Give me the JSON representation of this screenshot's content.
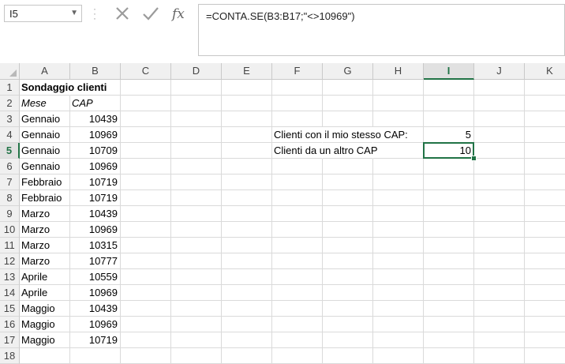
{
  "name_box": {
    "value": "I5"
  },
  "formula_bar": {
    "value": "=CONTA.SE(B3:B17;\"<>10969\")"
  },
  "columns": [
    "A",
    "B",
    "C",
    "D",
    "E",
    "F",
    "G",
    "H",
    "I",
    "J",
    "K"
  ],
  "active_column": "I",
  "active_row": "5",
  "rows": [
    "1",
    "2",
    "3",
    "4",
    "5",
    "6",
    "7",
    "8",
    "9",
    "10",
    "11",
    "12",
    "13",
    "14",
    "15",
    "16",
    "17",
    "18"
  ],
  "sheet": {
    "title": "Sondaggio clienti",
    "headers": {
      "month": "Mese",
      "cap": "CAP"
    },
    "data": [
      {
        "month": "Gennaio",
        "cap": "10439"
      },
      {
        "month": "Gennaio",
        "cap": "10969"
      },
      {
        "month": "Gennaio",
        "cap": "10709"
      },
      {
        "month": "Gennaio",
        "cap": "10969"
      },
      {
        "month": "Febbraio",
        "cap": "10719"
      },
      {
        "month": "Febbraio",
        "cap": "10719"
      },
      {
        "month": "Marzo",
        "cap": "10439"
      },
      {
        "month": "Marzo",
        "cap": "10969"
      },
      {
        "month": "Marzo",
        "cap": "10315"
      },
      {
        "month": "Marzo",
        "cap": "10777"
      },
      {
        "month": "Aprile",
        "cap": "10559"
      },
      {
        "month": "Aprile",
        "cap": "10969"
      },
      {
        "month": "Maggio",
        "cap": "10439"
      },
      {
        "month": "Maggio",
        "cap": "10969"
      },
      {
        "month": "Maggio",
        "cap": "10719"
      }
    ],
    "summary": {
      "same_cap_label": "Clienti con il mio stesso CAP:",
      "same_cap_value": "5",
      "other_cap_label": "Clienti da un altro CAP",
      "other_cap_value": "10"
    }
  },
  "colors": {
    "accent": "#217346",
    "header_bg": "#f0f0f0",
    "grid": "#dadada"
  },
  "icons": {
    "cancel": "cancel-icon",
    "confirm": "confirm-icon",
    "function": "insert-function-icon"
  }
}
